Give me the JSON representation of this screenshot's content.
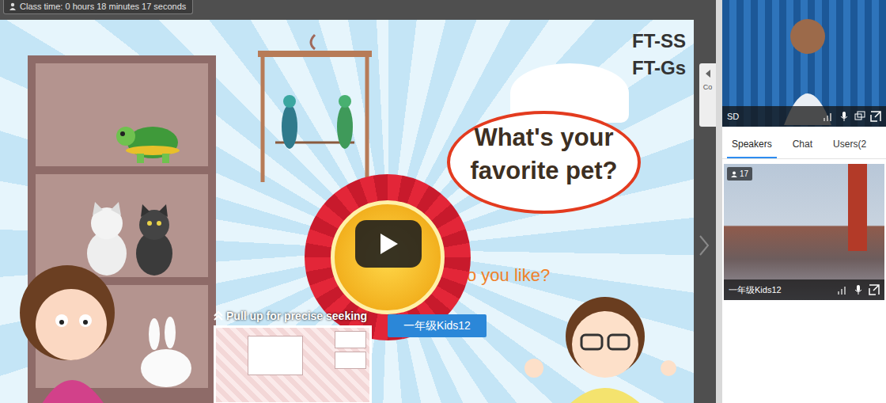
{
  "header": {
    "class_time": "Class time: 0 hours 18 minutes 17 seconds"
  },
  "slide": {
    "labels": [
      "FT-SS",
      "FT-Gs"
    ],
    "question": "What's your favorite pet?",
    "subquestion": "o you like?",
    "ribbon": "一年级Kids12",
    "collapse_tab": "Co"
  },
  "player": {
    "seek_hint": "Pull up for precise seeking"
  },
  "teacher": {
    "name": "SD"
  },
  "tabs": [
    {
      "label": "Speakers",
      "selected": true
    },
    {
      "label": "Chat",
      "selected": false
    },
    {
      "label": "Users(2",
      "selected": false
    }
  ],
  "student": {
    "count": "17",
    "name": "一年级Kids12"
  }
}
